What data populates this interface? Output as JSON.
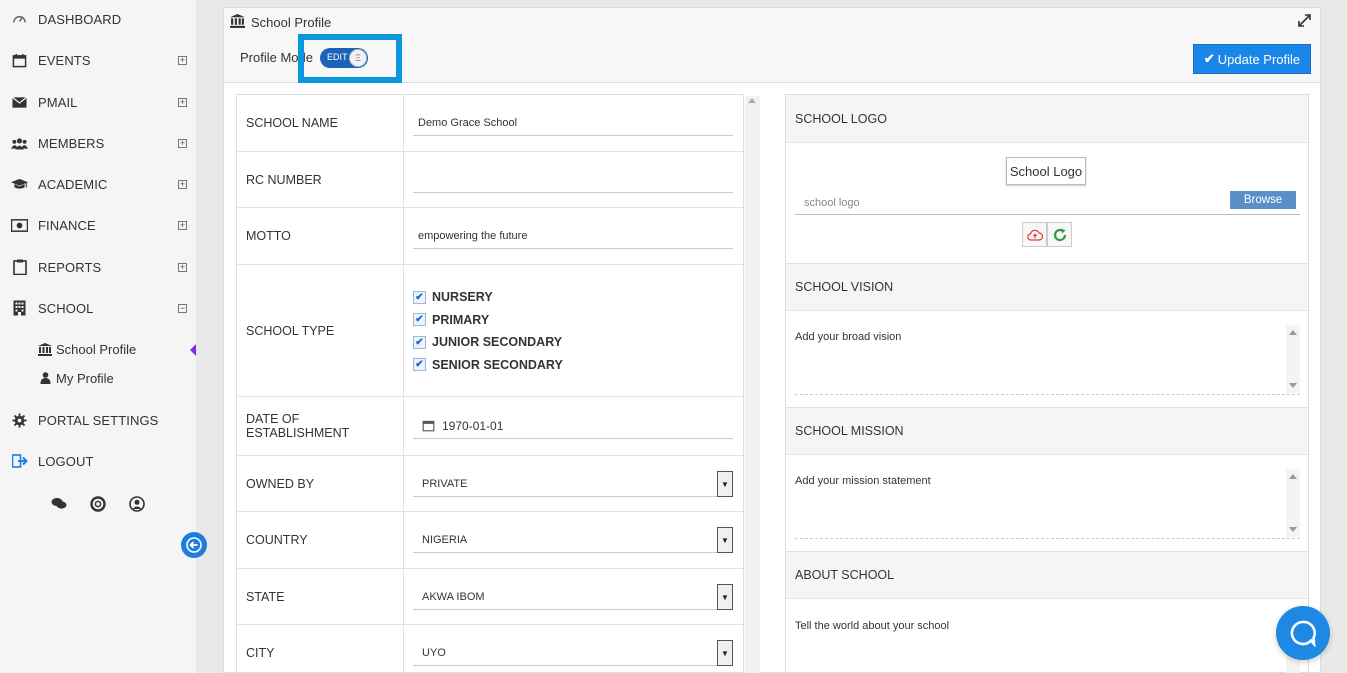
{
  "sidebar": {
    "items": [
      {
        "label": "DASHBOARD",
        "icon": "dashboard-icon",
        "expander": ""
      },
      {
        "label": "EVENTS",
        "icon": "calendar-icon",
        "expander": "+"
      },
      {
        "label": "PMAIL",
        "icon": "envelope-icon",
        "expander": "+"
      },
      {
        "label": "MEMBERS",
        "icon": "users-icon",
        "expander": "+"
      },
      {
        "label": "ACADEMIC",
        "icon": "graduation-cap-icon",
        "expander": "+"
      },
      {
        "label": "FINANCE",
        "icon": "money-icon",
        "expander": "+"
      },
      {
        "label": "REPORTS",
        "icon": "clipboard-icon",
        "expander": "+"
      },
      {
        "label": "SCHOOL",
        "icon": "building-icon",
        "expander": "−"
      },
      {
        "label": "PORTAL SETTINGS",
        "icon": "gear-icon",
        "expander": ""
      },
      {
        "label": "LOGOUT",
        "icon": "logout-icon",
        "expander": ""
      }
    ],
    "sub_items": [
      {
        "label": "School Profile",
        "icon": "institution-icon"
      },
      {
        "label": "My Profile",
        "icon": "user-icon"
      }
    ],
    "footer_icons": [
      "chat-icon",
      "support-icon",
      "account-icon"
    ]
  },
  "panel": {
    "title": "School Profile",
    "mode_label": "Profile Mode",
    "toggle_label": "EDIT",
    "toggle_knob": "Ξ",
    "update_label": "Update Profile",
    "update_check": "✔"
  },
  "form": {
    "school_name_label": "SCHOOL NAME",
    "school_name_value": "Demo Grace School",
    "rc_number_label": "RC NUMBER",
    "rc_number_value": "",
    "motto_label": "MOTTO",
    "motto_value": "empowering the future",
    "school_type_label": "SCHOOL TYPE",
    "school_types": [
      "NURSERY",
      "PRIMARY",
      "JUNIOR SECONDARY",
      "SENIOR SECONDARY"
    ],
    "date_label": "DATE OF ESTABLISHMENT",
    "date_value": "1970-01-01",
    "owned_by_label": "OWNED BY",
    "owned_by_value": "PRIVATE",
    "country_label": "COUNTRY",
    "country_value": "NIGERIA",
    "state_label": "STATE",
    "state_value": "AKWA IBOM",
    "city_label": "CITY",
    "city_value": "UYO"
  },
  "right": {
    "logo_header": "SCHOOL LOGO",
    "logo_chip": "School Logo",
    "logo_placeholder": "school logo",
    "browse_label": "Browse",
    "vision_header": "SCHOOL VISION",
    "vision_placeholder": "Add your broad vision",
    "mission_header": "SCHOOL MISSION",
    "mission_placeholder": "Add your mission statement",
    "about_header": "ABOUT SCHOOL",
    "about_placeholder": "Tell the world about your school"
  },
  "colors": {
    "accent": "#1a87e8",
    "highlight": "#0a97dd",
    "toggle": "#1a63b8",
    "active_marker": "#8a2be2"
  }
}
